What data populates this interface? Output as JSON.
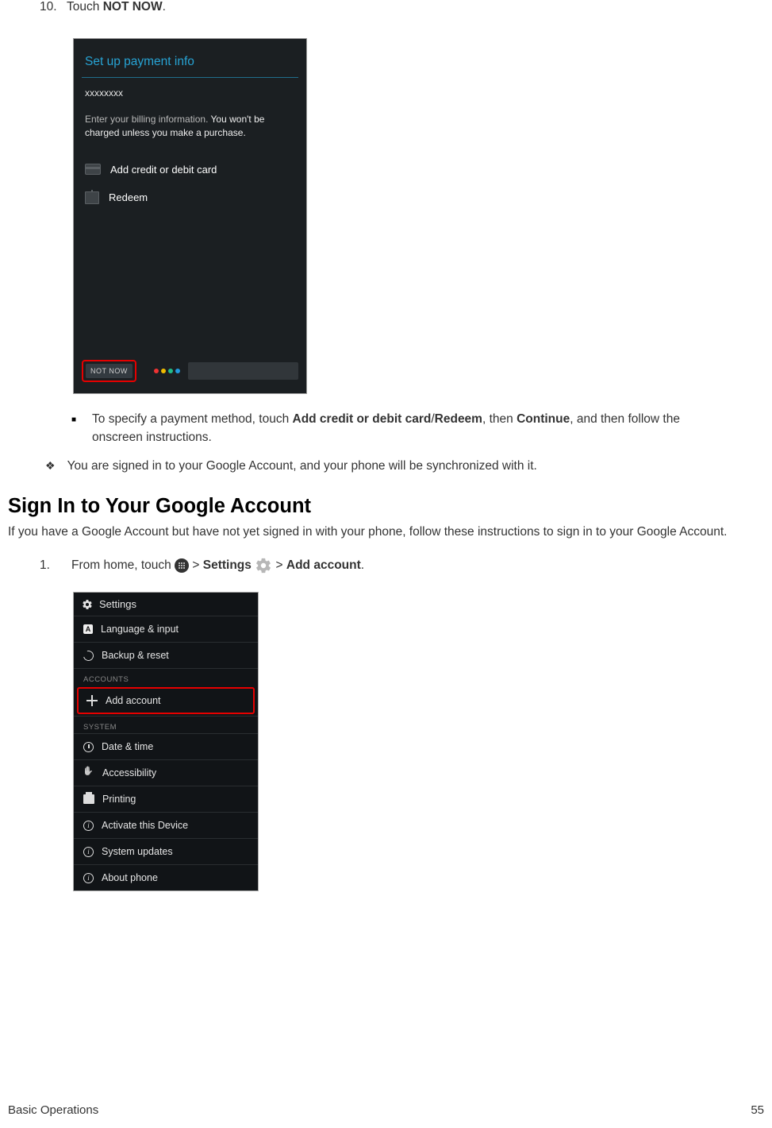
{
  "step10": {
    "num": "10.",
    "prefix": "Touch ",
    "bold": "NOT NOW",
    "suffix": "."
  },
  "ss1": {
    "title": "Set up payment info",
    "sub": "xxxxxxxx",
    "desc_a": "Enter your billing information. ",
    "desc_b": "You won't be charged unless you make a purchase.",
    "opt1": "Add credit or debit card",
    "opt2": "Redeem",
    "notnow": "NOT NOW"
  },
  "bullet": {
    "a": "To specify a payment method, touch ",
    "b1": "Add credit or debit card",
    "slash": "/",
    "b2": "Redeem",
    "c": ", then ",
    "b3": "Continue",
    "d": ", and then follow the onscreen instructions."
  },
  "diamond": "You are signed in to your Google Account, and your phone will be synchronized with it.",
  "heading": "Sign In to Your Google Account",
  "para": "If you have a Google Account but have not yet signed in with your phone, follow these instructions to sign in to your Google Account.",
  "step1": {
    "num": "1.",
    "a": "From home, touch ",
    "gt1": " > ",
    "b1": "Settings",
    "gt2": " > ",
    "b2": "Add account",
    "dot": "."
  },
  "ss2": {
    "header": "Settings",
    "row_lang": "Language & input",
    "row_backup": "Backup & reset",
    "section_accounts": "ACCOUNTS",
    "row_add": "Add account",
    "section_system": "SYSTEM",
    "row_date": "Date & time",
    "row_access": "Accessibility",
    "row_print": "Printing",
    "row_activate": "Activate this Device",
    "row_updates": "System updates",
    "row_about": "About phone"
  },
  "footer": {
    "left": "Basic Operations",
    "right": "55"
  }
}
